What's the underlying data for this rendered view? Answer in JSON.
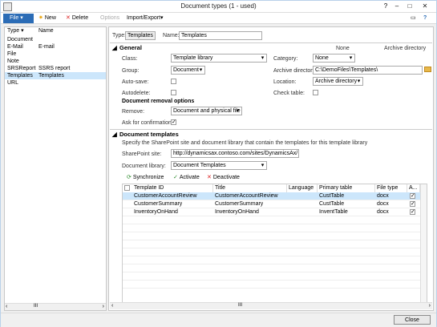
{
  "window": {
    "title": "Document types (1 - used)",
    "help": "?",
    "min": "–",
    "max": "□",
    "close": "✕"
  },
  "menu": {
    "file": "File",
    "new": "New",
    "delete": "Delete",
    "options": "Options",
    "import_export": "Import/Export"
  },
  "list": {
    "col_type": "Type",
    "col_name": "Name",
    "rows": [
      {
        "type": "Document",
        "name": ""
      },
      {
        "type": "E-Mail",
        "name": "E-mail"
      },
      {
        "type": "File",
        "name": ""
      },
      {
        "type": "Note",
        "name": ""
      },
      {
        "type": "SRSReport",
        "name": "SSRS report"
      },
      {
        "type": "Templates",
        "name": "Templates"
      },
      {
        "type": "URL",
        "name": ""
      }
    ]
  },
  "header": {
    "type_label": "Type:",
    "type_value": "Templates",
    "name_label": "Name:",
    "name_value": "Templates"
  },
  "general": {
    "title": "General",
    "none": "None",
    "archive_dir": "Archive directory",
    "class_label": "Class:",
    "class_value": "Template library",
    "group_label": "Group:",
    "group_value": "Document",
    "autosave_label": "Auto-save:",
    "autodelete_label": "Autodelete:",
    "category_label": "Category:",
    "category_value": "None",
    "archive_label": "Archive directory:",
    "archive_value": "C:\\DemoFiles\\Templates\\",
    "location_label": "Location:",
    "location_value": "Archive directory",
    "checktable_label": "Check table:",
    "removal_title": "Document removal options",
    "remove_label": "Remove:",
    "remove_value": "Document and physical file",
    "ask_label": "Ask for confirmation:"
  },
  "templates": {
    "title": "Document templates",
    "desc": "Specify the SharePoint site and document library that contain the templates for this template library",
    "site_label": "SharePoint site:",
    "site_value": "http://dynamicsax.contoso.com/sites/DynamicsAx/",
    "lib_label": "Document library:",
    "lib_value": "Document Templates",
    "sync": "Synchronize",
    "activate": "Activate",
    "deactivate": "Deactivate",
    "cols": [
      "Template ID",
      "Title",
      "Language",
      "Primary table",
      "File type",
      "A..."
    ],
    "rows": [
      {
        "id": "CustomerAccountReview",
        "title": "CustomerAccountReview",
        "lang": "",
        "table": "CustTable",
        "ft": "docx",
        "active": true
      },
      {
        "id": "CustomerSummary",
        "title": "CustomerSummary",
        "lang": "",
        "table": "CustTable",
        "ft": "docx",
        "active": true
      },
      {
        "id": "InventoryOnHand",
        "title": "InventoryOnHand",
        "lang": "",
        "table": "InventTable",
        "ft": "docx",
        "active": true
      }
    ]
  },
  "footer": {
    "close": "Close"
  },
  "scroll": {
    "left_grip": "III",
    "right_grip": "III"
  }
}
